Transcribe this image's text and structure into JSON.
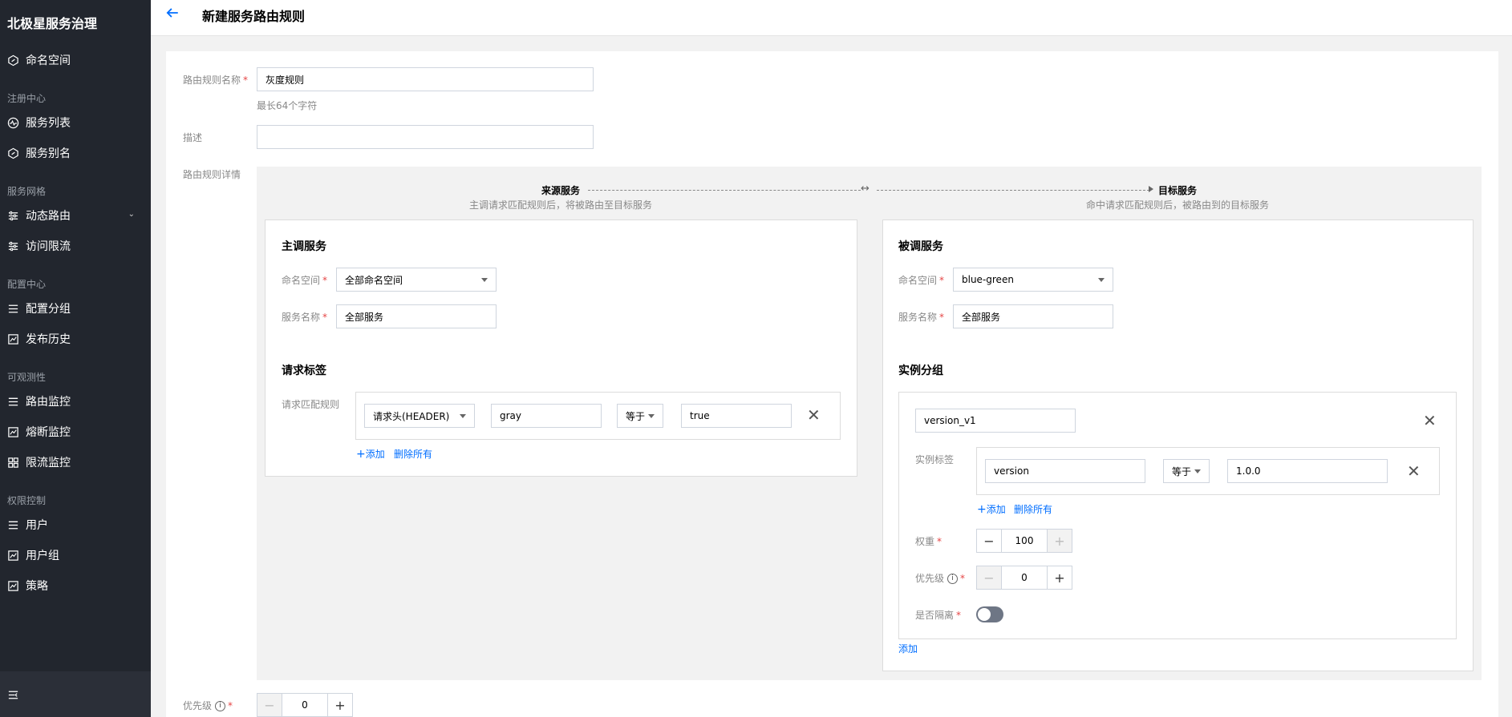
{
  "sidebar": {
    "brand": "北极星服务治理",
    "items": {
      "namespace": "命名空间",
      "service_list": "服务列表",
      "service_alias": "服务别名",
      "dynamic_route": "动态路由",
      "rate_limit": "访问限流",
      "config_group": "配置分组",
      "release_history": "发布历史",
      "route_monitor": "路由监控",
      "circuit_monitor": "熔断监控",
      "limit_monitor": "限流监控",
      "user": "用户",
      "user_group": "用户组",
      "policy": "策略"
    },
    "groups": {
      "registry": "注册中心",
      "mesh": "服务网格",
      "config": "配置中心",
      "observability": "可观测性",
      "access": "权限控制"
    }
  },
  "header": {
    "title": "新建服务路由规则"
  },
  "form": {
    "name_label": "路由规则名称",
    "name_value": "灰度规则",
    "name_hint": "最长64个字符",
    "desc_label": "描述",
    "desc_value": "",
    "detail_label": "路由规则详情",
    "priority_label": "优先级",
    "priority_value": "0"
  },
  "flow": {
    "source_title": "来源服务",
    "source_sub": "主调请求匹配规则后，将被路由至目标服务",
    "target_title": "目标服务",
    "target_sub": "命中请求匹配规则后，被路由到的目标服务",
    "swap_icon": "↔"
  },
  "source": {
    "title": "主调服务",
    "ns_label": "命名空间",
    "ns_value": "全部命名空间",
    "svc_label": "服务名称",
    "svc_value": "全部服务",
    "tags_title": "请求标签",
    "rule_label": "请求匹配规则",
    "rule": {
      "type": "请求头(HEADER)",
      "key": "gray",
      "op": "等于",
      "value": "true"
    },
    "add": "添加",
    "delete_all": "删除所有"
  },
  "target": {
    "title": "被调服务",
    "ns_label": "命名空间",
    "ns_value": "blue-green",
    "svc_label": "服务名称",
    "svc_value": "全部服务",
    "group_title": "实例分组",
    "group_name": "version_v1",
    "tag_label": "实例标签",
    "tag": {
      "key": "version",
      "op": "等于",
      "value": "1.0.0"
    },
    "add": "添加",
    "delete_all": "删除所有",
    "weight_label": "权重",
    "weight_value": "100",
    "priority_label": "优先级",
    "priority_value": "0",
    "isolate_label": "是否隔离",
    "add_group": "添加"
  },
  "colors": {
    "accent": "#006eff",
    "sidebar": "#22262e",
    "required": "#e54545"
  }
}
